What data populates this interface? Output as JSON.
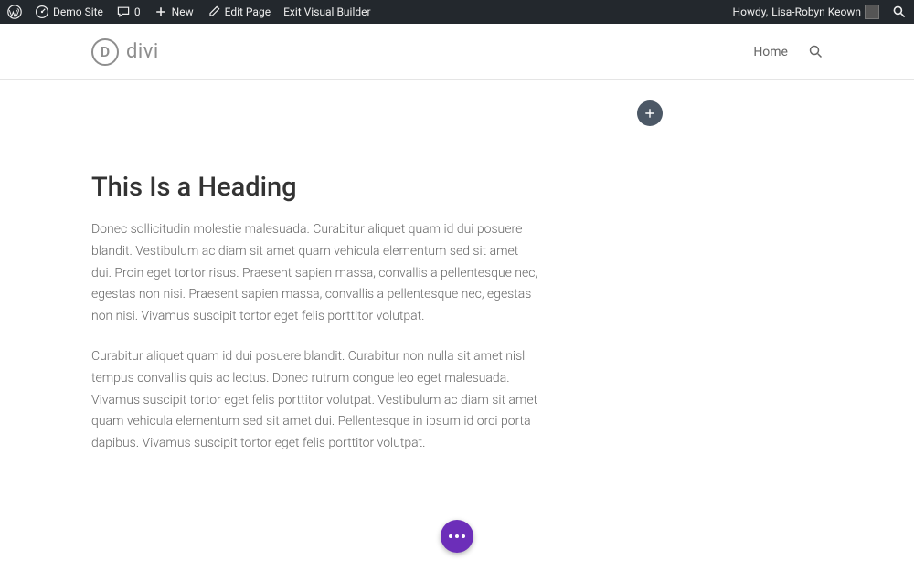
{
  "adminbar": {
    "site_name": "Demo Site",
    "comments_count": "0",
    "new_label": "New",
    "edit_page_label": "Edit Page",
    "exit_vb_label": "Exit Visual Builder",
    "howdy_prefix": "Howdy, ",
    "user_name": "Lisa-Robyn Keown"
  },
  "header": {
    "logo_letter": "D",
    "logo_text": "divi",
    "nav_home": "Home"
  },
  "content": {
    "heading": "This Is a Heading",
    "para1": "Donec sollicitudin molestie malesuada. Curabitur aliquet quam id dui posuere blandit. Vestibulum ac diam sit amet quam vehicula elementum sed sit amet dui. Proin eget tortor risus. Praesent sapien massa, convallis a pellentesque nec, egestas non nisi. Praesent sapien massa, convallis a pellentesque nec, egestas non nisi. Vivamus suscipit tortor eget felis porttitor volutpat.",
    "para2": "Curabitur aliquet quam id dui posuere blandit. Curabitur non nulla sit amet nisl tempus convallis quis ac lectus. Donec rutrum congue leo eget malesuada. Vivamus suscipit tortor eget felis porttitor volutpat. Vestibulum ac diam sit amet quam vehicula elementum sed sit amet dui. Pellentesque in ipsum id orci porta dapibus. Vivamus suscipit tortor eget felis porttitor volutpat."
  }
}
